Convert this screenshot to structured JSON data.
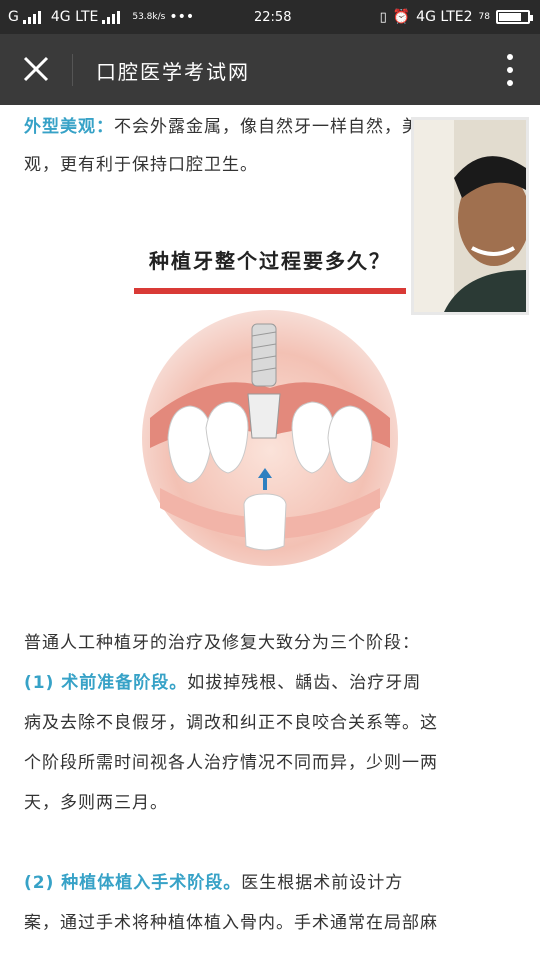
{
  "status_bar": {
    "left": [
      "G",
      "4G LTE"
    ],
    "speed": "53.8k/s",
    "dots": "•••",
    "time": "22:58",
    "right_network": "4G LTE2",
    "battery_pct": "78",
    "battery_level": 0.78
  },
  "header": {
    "title": "口腔医学考试网"
  },
  "article": {
    "para1_label": "外型美观：",
    "para1_text": "不会外露金属，像自然牙一样自然，美",
    "para1_line2": "观，更有利于保持口腔卫生。",
    "section_title": "种植牙整个过程要多久？",
    "intro": "普通人工种植牙的治疗及修复大致分为三个阶段：",
    "stage1_label": "(1) 术前准备阶段。",
    "stage1_text1": "如拔掉残根、龋齿、治疗牙周",
    "stage1_text2": "病及去除不良假牙，调改和纠正不良咬合关系等。这",
    "stage1_text3": "个阶段所需时间视各人治疗情况不同而异，少则一两",
    "stage1_text4": "天，多则两三月。",
    "stage2_label": "(2) 种植体植入手术阶段。",
    "stage2_text1": "医生根据术前设计方",
    "stage2_text2": "案，通过手术将种植体植入骨内。手术通常在局部麻"
  },
  "icons": {
    "close": "close-icon",
    "more": "more-vertical-icon",
    "alarm": "alarm-icon",
    "vibrate": "vibrate-icon"
  },
  "colors": {
    "accent_blue": "#37a2c7",
    "rule_red": "#d93a36",
    "titlebar": "#3a3a3a"
  }
}
